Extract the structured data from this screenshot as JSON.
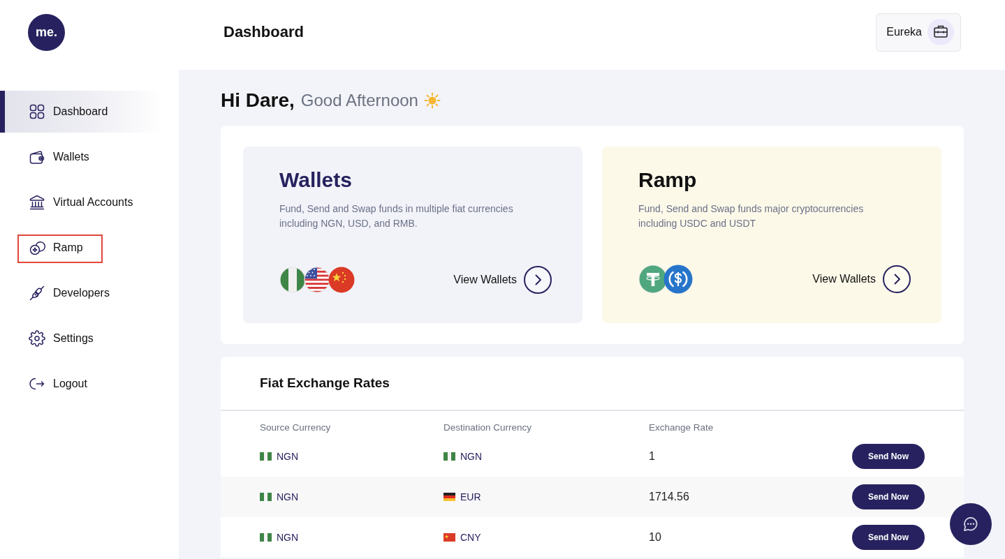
{
  "sidebar": {
    "logo": "me.",
    "items": [
      {
        "label": "Dashboard",
        "selected": true,
        "highlighted": false
      },
      {
        "label": "Wallets",
        "selected": false,
        "highlighted": false
      },
      {
        "label": "Virtual Accounts",
        "selected": false,
        "highlighted": false
      },
      {
        "label": "Ramp",
        "selected": false,
        "highlighted": true
      },
      {
        "label": "Developers",
        "selected": false,
        "highlighted": false
      },
      {
        "label": "Settings",
        "selected": false,
        "highlighted": false
      },
      {
        "label": "Logout",
        "selected": false,
        "highlighted": false
      }
    ]
  },
  "header": {
    "title": "Dashboard",
    "account": "Eureka"
  },
  "greeting": {
    "name": "Hi Dare,",
    "message": "Good Afternoon"
  },
  "cards": [
    {
      "kind": "fiat",
      "title": "Wallets",
      "description": "Fund, Send and Swap funds in multiple fiat currencies including NGN, USD, and RMB.",
      "link": "View Wallets"
    },
    {
      "kind": "crypto",
      "title": "Ramp",
      "description": "Fund, Send and Swap funds major cryptocurrencies including USDC and USDT",
      "link": "View Wallets"
    }
  ],
  "rates_table": {
    "title": "Fiat Exchange Rates",
    "columns": [
      "Source Currency",
      "Destination Currency",
      "Exchange Rate"
    ],
    "rows": [
      {
        "source": "NGN",
        "destination": "NGN",
        "rate": "1",
        "action": "Send Now"
      },
      {
        "source": "NGN",
        "destination": "EUR",
        "rate": "1714.56",
        "action": "Send Now"
      },
      {
        "source": "NGN",
        "destination": "CNY",
        "rate": "10",
        "action": "Send Now"
      }
    ]
  }
}
